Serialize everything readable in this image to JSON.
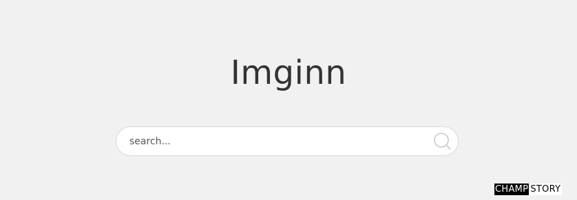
{
  "header": {
    "site_title": "Imginn"
  },
  "search": {
    "placeholder": "search...",
    "value": "",
    "button_icon": "search-icon"
  },
  "brand": {
    "left": "CHAMP",
    "right": "STORY"
  },
  "colors": {
    "background": "#f1f1f1",
    "title": "#333333",
    "search_border": "#d8d8d8"
  }
}
